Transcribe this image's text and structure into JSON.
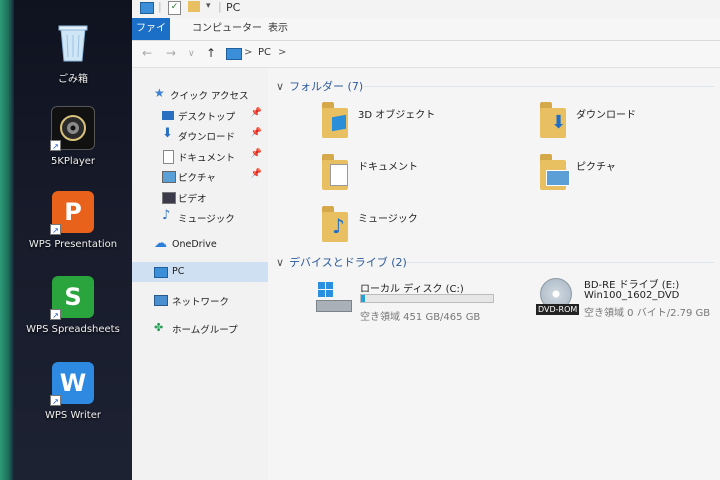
{
  "desktop": {
    "icons": [
      {
        "label": "ごみ箱",
        "icon": "recycle-bin-icon"
      },
      {
        "label": "5KPlayer",
        "icon": "5kplayer-icon"
      },
      {
        "label": "WPS Presentation",
        "icon": "wps-presentation-icon",
        "letter": "P",
        "color": "#e8621b"
      },
      {
        "label": "WPS Spreadsheets",
        "icon": "wps-spreadsheets-icon",
        "letter": "S",
        "color": "#2aa43d"
      },
      {
        "label": "WPS Writer",
        "icon": "wps-writer-icon",
        "letter": "W",
        "color": "#2e8ae0"
      }
    ]
  },
  "titlebar": {
    "title": "PC"
  },
  "ribbon": {
    "tabs": [
      "ファイル",
      "コンピューター",
      "表示"
    ],
    "accent": "#1b6fc7"
  },
  "address": {
    "path_label": "PC",
    "sep": ">"
  },
  "nav": {
    "quick_access": "クイック アクセス",
    "quick_items": [
      {
        "label": "デスクトップ",
        "pinned": true
      },
      {
        "label": "ダウンロード",
        "pinned": true
      },
      {
        "label": "ドキュメント",
        "pinned": true
      },
      {
        "label": "ピクチャ",
        "pinned": true
      },
      {
        "label": "ビデオ",
        "pinned": false
      },
      {
        "label": "ミュージック",
        "pinned": false
      }
    ],
    "onedrive": "OneDrive",
    "pc": "PC",
    "network": "ネットワーク",
    "homegroup": "ホームグループ"
  },
  "content": {
    "folders_header": "フォルダー (7)",
    "folders": [
      {
        "name": "3D オブジェクト",
        "icon": "3d-objects-icon"
      },
      {
        "name": "ダウンロード",
        "icon": "downloads-folder-icon"
      },
      {
        "name": "ドキュメント",
        "icon": "documents-folder-icon"
      },
      {
        "name": "ピクチャ",
        "icon": "pictures-folder-icon"
      },
      {
        "name": "ミュージック",
        "icon": "music-folder-icon"
      }
    ],
    "devices_header": "デバイスとドライブ (2)",
    "drives": [
      {
        "name": "ローカル ディスク (C:)",
        "free": "空き領域 451 GB/465 GB",
        "used_fraction": 0.03
      },
      {
        "name": "BD-RE ドライブ (E:)",
        "volume": "Win100_1602_DVD",
        "free": "空き領域 0 バイト/2.79 GB",
        "badge": "DVD-ROM"
      }
    ]
  }
}
